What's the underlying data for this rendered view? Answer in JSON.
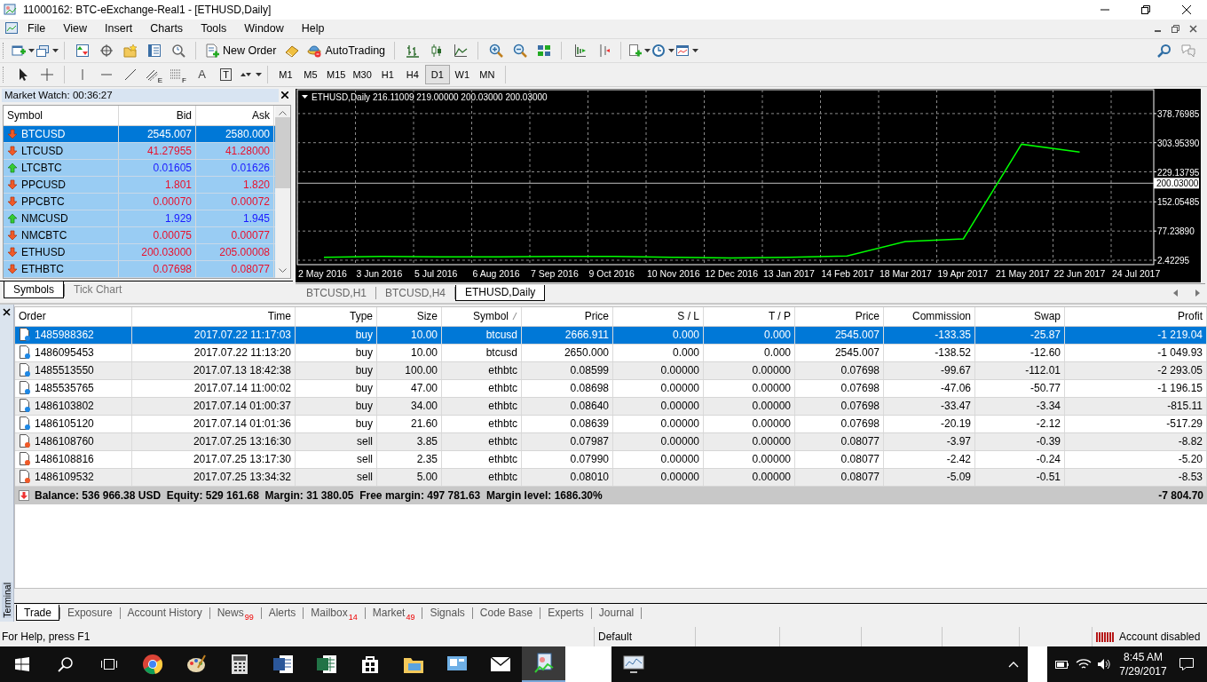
{
  "window": {
    "title": "11000162: BTC-eExchange-Real1 - [ETHUSD,Daily]"
  },
  "menu": [
    "File",
    "View",
    "Insert",
    "Charts",
    "Tools",
    "Window",
    "Help"
  ],
  "toolbar": {
    "buttons": [
      "New Order",
      "AutoTrading"
    ]
  },
  "drawing_tools": [
    {
      "kind": "channel",
      "label": "E"
    },
    {
      "kind": "levels",
      "label": "F"
    },
    {
      "kind": "text",
      "label": "A"
    },
    {
      "kind": "label",
      "label": "T"
    }
  ],
  "timeframes": [
    {
      "label": "M1",
      "selected": false
    },
    {
      "label": "M5",
      "selected": false
    },
    {
      "label": "M15",
      "selected": false
    },
    {
      "label": "M30",
      "selected": false
    },
    {
      "label": "H1",
      "selected": false
    },
    {
      "label": "H4",
      "selected": false
    },
    {
      "label": "D1",
      "selected": true
    },
    {
      "label": "W1",
      "selected": false
    },
    {
      "label": "MN",
      "selected": false
    }
  ],
  "market_watch": {
    "title": "Market Watch: 00:36:27",
    "columns": [
      "Symbol",
      "Bid",
      "Ask"
    ],
    "rows": [
      {
        "symbol": "BTCUSD",
        "bid": "2545.007",
        "ask": "2580.000",
        "kind": "down",
        "selected": true
      },
      {
        "symbol": "LTCUSD",
        "bid": "41.27955",
        "ask": "41.28000",
        "kind": "down",
        "selected": false
      },
      {
        "symbol": "LTCBTC",
        "bid": "0.01605",
        "ask": "0.01626",
        "kind": "up",
        "selected": false
      },
      {
        "symbol": "PPCUSD",
        "bid": "1.801",
        "ask": "1.820",
        "kind": "down",
        "selected": false
      },
      {
        "symbol": "PPCBTC",
        "bid": "0.00070",
        "ask": "0.00072",
        "kind": "down",
        "selected": false
      },
      {
        "symbol": "NMCUSD",
        "bid": "1.929",
        "ask": "1.945",
        "kind": "up",
        "selected": false
      },
      {
        "symbol": "NMCBTC",
        "bid": "0.00075",
        "ask": "0.00077",
        "kind": "down",
        "selected": false
      },
      {
        "symbol": "ETHUSD",
        "bid": "200.03000",
        "ask": "205.00008",
        "kind": "down",
        "selected": false
      },
      {
        "symbol": "ETHBTC",
        "bid": "0.07698",
        "ask": "0.08077",
        "kind": "down",
        "selected": false
      }
    ],
    "tabs": [
      {
        "label": "Symbols",
        "selected": true
      },
      {
        "label": "Tick Chart",
        "selected": false
      }
    ]
  },
  "chart": {
    "readout": "216.11009 219.00000 200.03000 200.03000",
    "chart_data": {
      "type": "line",
      "title": "ETHUSD,Daily",
      "categories": [
        "2 May 2016",
        "3 Jun 2016",
        "5 Jul 2016",
        "6 Aug 2016",
        "7 Sep 2016",
        "9 Oct 2016",
        "10 Nov 2016",
        "12 Dec 2016",
        "13 Jan 2017",
        "14 Feb 2017",
        "18 Mar 2017",
        "19 Apr 2017",
        "21 May 2017",
        "22 Jun 2017",
        "24 Jul 2017"
      ],
      "series": [
        {
          "color": "#00ff00",
          "values": [
            10,
            12,
            11,
            11,
            12,
            12,
            10,
            8,
            10,
            13,
            50,
            57,
            300,
            280,
            null
          ]
        }
      ],
      "grid": true,
      "ylim": [
        -9,
        440
      ],
      "yticks": [
        {
          "value": 2.42295,
          "label": "2.42295"
        },
        {
          "value": 77.2389,
          "label": "77.23890"
        },
        {
          "value": 152.05485,
          "label": "152.05485"
        },
        {
          "value": 229.13795,
          "label": "229.13795"
        },
        {
          "value": 303.9539,
          "label": "303.95390"
        },
        {
          "value": 378.76985,
          "label": "378.76985"
        }
      ],
      "ref_lines": [
        {
          "axis": "y",
          "value": 200.03,
          "label": "200.03000"
        }
      ]
    },
    "tabs": [
      {
        "label": "BTCUSD,H1",
        "selected": false
      },
      {
        "label": "BTCUSD,H4",
        "selected": false
      },
      {
        "label": "ETHUSD,Daily",
        "selected": true
      }
    ]
  },
  "terminal": {
    "side_label": "Terminal",
    "columns": [
      "Order",
      "Time",
      "Type",
      "Size",
      "Symbol",
      "Price",
      "S / L",
      "T / P",
      "Price",
      "Commission",
      "Swap",
      "Profit"
    ],
    "rows": [
      {
        "kind": "buy",
        "selected": true,
        "cells": [
          "1485988362",
          "2017.07.22 11:17:03",
          "buy",
          "10.00",
          "btcusd",
          "2666.911",
          "0.000",
          "0.000",
          "2545.007",
          "-133.35",
          "-25.87",
          "-1 219.04"
        ]
      },
      {
        "kind": "buy",
        "selected": false,
        "cells": [
          "1486095453",
          "2017.07.22 11:13:20",
          "buy",
          "10.00",
          "btcusd",
          "2650.000",
          "0.000",
          "0.000",
          "2545.007",
          "-138.52",
          "-12.60",
          "-1 049.93"
        ]
      },
      {
        "kind": "buy",
        "selected": false,
        "cells": [
          "1485513550",
          "2017.07.13 18:42:38",
          "buy",
          "100.00",
          "ethbtc",
          "0.08599",
          "0.00000",
          "0.00000",
          "0.07698",
          "-99.67",
          "-112.01",
          "-2 293.05"
        ]
      },
      {
        "kind": "buy",
        "selected": false,
        "cells": [
          "1485535765",
          "2017.07.14 11:00:02",
          "buy",
          "47.00",
          "ethbtc",
          "0.08698",
          "0.00000",
          "0.00000",
          "0.07698",
          "-47.06",
          "-50.77",
          "-1 196.15"
        ]
      },
      {
        "kind": "buy",
        "selected": false,
        "cells": [
          "1486103802",
          "2017.07.14 01:00:37",
          "buy",
          "34.00",
          "ethbtc",
          "0.08640",
          "0.00000",
          "0.00000",
          "0.07698",
          "-33.47",
          "-3.34",
          "-815.11"
        ]
      },
      {
        "kind": "buy",
        "selected": false,
        "cells": [
          "1486105120",
          "2017.07.14 01:01:36",
          "buy",
          "21.60",
          "ethbtc",
          "0.08639",
          "0.00000",
          "0.00000",
          "0.07698",
          "-20.19",
          "-2.12",
          "-517.29"
        ]
      },
      {
        "kind": "sell",
        "selected": false,
        "cells": [
          "1486108760",
          "2017.07.25 13:16:30",
          "sell",
          "3.85",
          "ethbtc",
          "0.07987",
          "0.00000",
          "0.00000",
          "0.08077",
          "-3.97",
          "-0.39",
          "-8.82"
        ]
      },
      {
        "kind": "sell",
        "selected": false,
        "cells": [
          "1486108816",
          "2017.07.25 13:17:30",
          "sell",
          "2.35",
          "ethbtc",
          "0.07990",
          "0.00000",
          "0.00000",
          "0.08077",
          "-2.42",
          "-0.24",
          "-5.20"
        ]
      },
      {
        "kind": "sell",
        "selected": false,
        "cells": [
          "1486109532",
          "2017.07.25 13:34:32",
          "sell",
          "5.00",
          "ethbtc",
          "0.08010",
          "0.00000",
          "0.00000",
          "0.08077",
          "-5.09",
          "-0.51",
          "-8.53"
        ]
      }
    ],
    "summary": {
      "text": "Balance: 536 966.38 USD  Equity: 529 161.68  Margin: 31 380.05  Free margin: 497 781.63  Margin level: 1686.30%",
      "profit": "-7 804.70"
    },
    "tabs": [
      {
        "label": "Trade",
        "selected": true
      },
      {
        "label": "Exposure",
        "selected": false
      },
      {
        "label": "Account History",
        "selected": false
      },
      {
        "label": "News",
        "count": "99",
        "selected": false
      },
      {
        "label": "Alerts",
        "selected": false
      },
      {
        "label": "Mailbox",
        "count": "14",
        "selected": false
      },
      {
        "label": "Market",
        "count": "49",
        "selected": false
      },
      {
        "label": "Signals",
        "selected": false
      },
      {
        "label": "Code Base",
        "selected": false
      },
      {
        "label": "Experts",
        "selected": false
      },
      {
        "label": "Journal",
        "selected": false
      }
    ]
  },
  "status_bar": [
    "For Help, press F1",
    "Default",
    "Account disabled"
  ],
  "taskbar": {
    "apps": [
      {
        "kind": "browser",
        "selected": false
      },
      {
        "kind": "paint",
        "selected": false
      },
      {
        "kind": "calculator",
        "selected": false
      },
      {
        "kind": "writer",
        "selected": false
      },
      {
        "kind": "sheet",
        "selected": false
      },
      {
        "kind": "store",
        "selected": false
      },
      {
        "kind": "folder",
        "selected": false
      },
      {
        "kind": "screen",
        "selected": false
      },
      {
        "kind": "mail",
        "selected": false
      },
      {
        "kind": "trader",
        "selected": true
      },
      {
        "kind": "blank",
        "selected": false
      },
      {
        "kind": "monitor",
        "selected": false
      }
    ],
    "time": "8:45 AM",
    "date": "7/29/2017"
  }
}
